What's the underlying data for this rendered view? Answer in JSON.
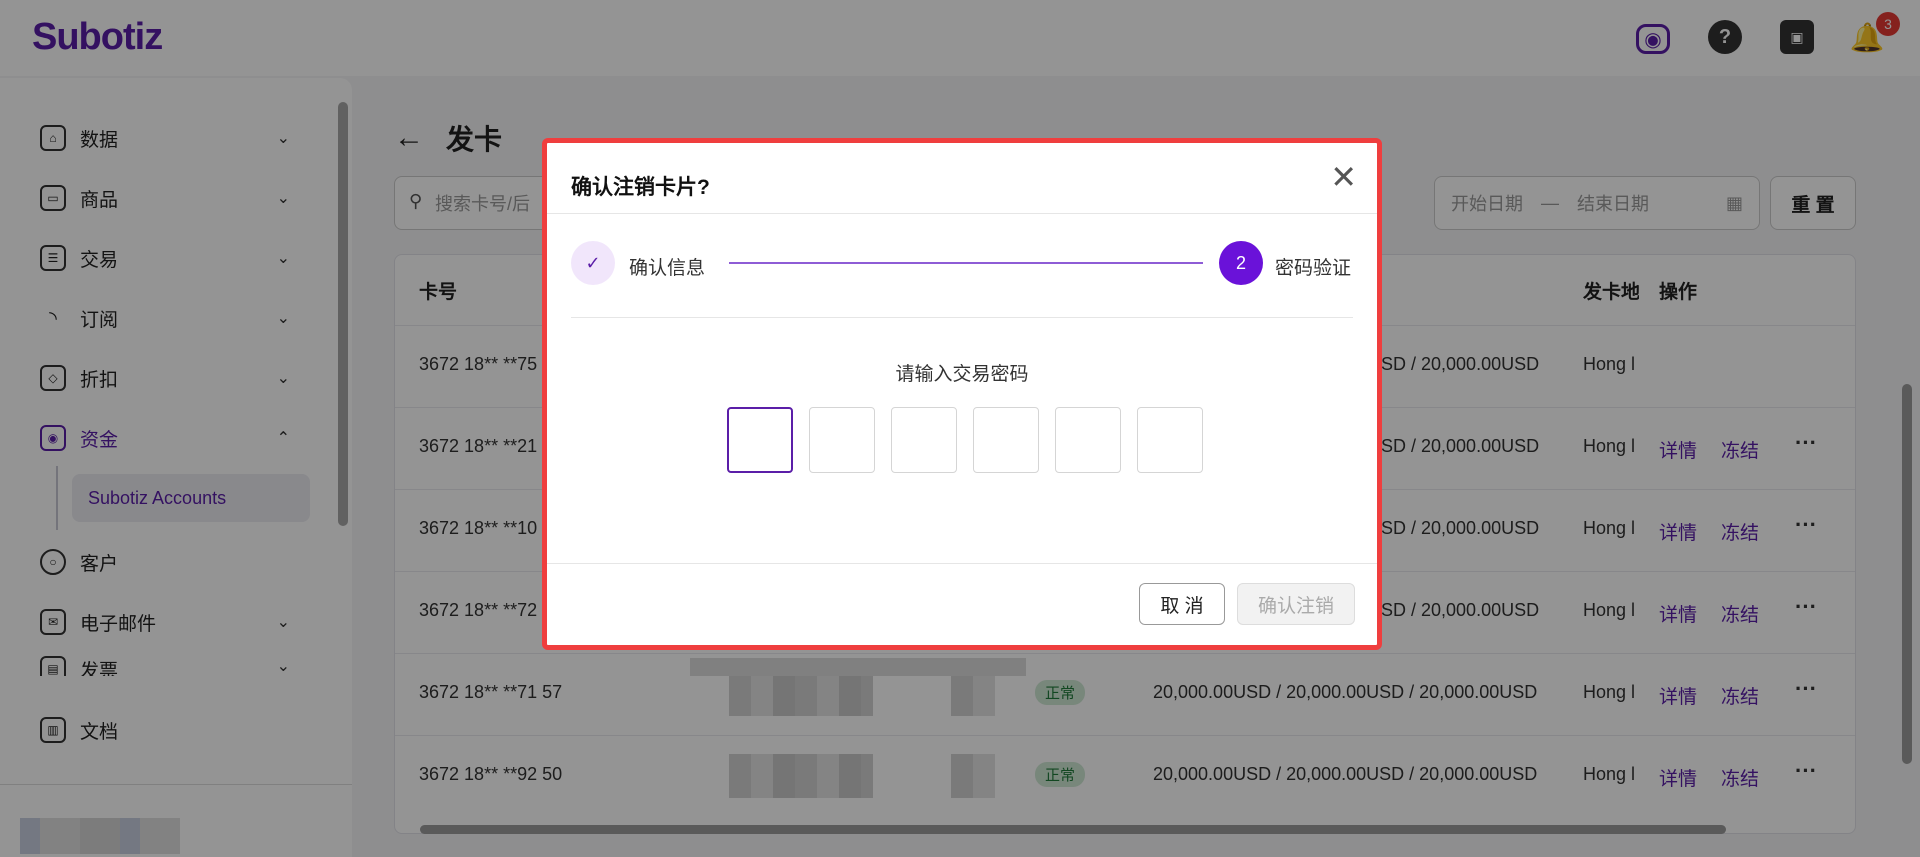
{
  "app": {
    "logo": "Subotiz",
    "notification_count": "3"
  },
  "sidebar": {
    "items": [
      {
        "label": "数据",
        "icon": "home-icon"
      },
      {
        "label": "商品",
        "icon": "store-icon"
      },
      {
        "label": "交易",
        "icon": "list-icon"
      },
      {
        "label": "订阅",
        "icon": "rss-icon"
      },
      {
        "label": "折扣",
        "icon": "tag-icon"
      },
      {
        "label": "资金",
        "icon": "wallet-icon"
      },
      {
        "label": "客户",
        "icon": "user-icon"
      },
      {
        "label": "电子邮件",
        "icon": "mail-icon"
      },
      {
        "label": "发票",
        "icon": "invoice-icon"
      },
      {
        "label": "文档",
        "icon": "doc-icon"
      }
    ],
    "sub_item": "Subotiz Accounts"
  },
  "page": {
    "title": "发卡",
    "search_placeholder": "搜索卡号/后",
    "start_date": "开始日期",
    "end_date": "结束日期",
    "date_sep": "—",
    "reset": "重 置"
  },
  "table": {
    "headers": {
      "card_no": "卡号",
      "region": "发卡地",
      "actions": "操作"
    },
    "rows": [
      {
        "card": "3672 18** **75",
        "amount": "SD / 20,000.00USD",
        "region": "Hong l"
      },
      {
        "card": "3672 18** **21",
        "amount": "SD / 20,000.00USD",
        "region": "Hong l"
      },
      {
        "card": "3672 18** **10",
        "amount": "SD / 20,000.00USD",
        "region": "Hong l"
      },
      {
        "card": "3672 18** **72",
        "amount": "SD / 20,000.00USD",
        "region": "Hong l"
      },
      {
        "card": "3672 18** **71 57",
        "status": "正常",
        "amount": "20,000.00USD / 20,000.00USD / 20,000.00USD",
        "region": "Hong l"
      },
      {
        "card": "3672 18** **92 50",
        "status": "正常",
        "amount": "20,000.00USD / 20,000.00USD / 20,000.00USD",
        "region": "Hong l"
      }
    ],
    "detail": "详情",
    "freeze": "冻结",
    "more": "···"
  },
  "modal": {
    "title": "确认注销卡片?",
    "step1": {
      "icon": "check-icon",
      "label": "确认信息"
    },
    "step2": {
      "number": "2",
      "label": "密码验证"
    },
    "prompt": "请输入交易密码",
    "cancel": "取 消",
    "confirm": "确认注销"
  }
}
